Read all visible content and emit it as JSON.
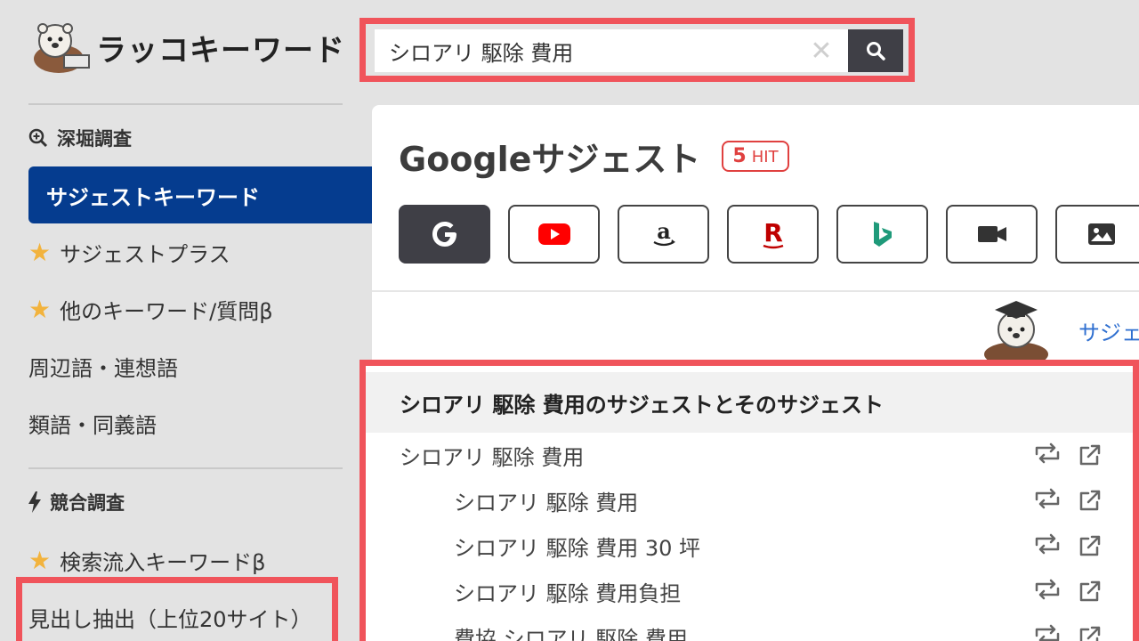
{
  "logo": {
    "text": "ラッコキーワード"
  },
  "search": {
    "value": "シロアリ 駆除 費用",
    "clear_label": "✕"
  },
  "sidebar": {
    "section1": "深堀調査",
    "active_item": "サジェストキーワード",
    "items1": [
      "サジェストプラス",
      "他のキーワード/質問β",
      "周辺語・連想語",
      "類語・同義語"
    ],
    "section2": "競合調査",
    "items2": [
      "検索流入キーワードβ",
      "見出し抽出（上位20サイト）"
    ]
  },
  "panel": {
    "title": "Googleサジェスト",
    "hit_count": "5",
    "hit_word": "HIT",
    "link_partial": "サジェ",
    "engines": [
      "google",
      "youtube",
      "amazon",
      "rakuten",
      "bing",
      "video",
      "image"
    ]
  },
  "results": {
    "header": "シロアリ 駆除 費用のサジェストとそのサジェスト",
    "rows": [
      {
        "text": "シロアリ 駆除 費用",
        "indent": 0
      },
      {
        "text": "シロアリ 駆除 費用",
        "indent": 1
      },
      {
        "text": "シロアリ 駆除 費用 30 坪",
        "indent": 1
      },
      {
        "text": "シロアリ 駆除 費用負担",
        "indent": 1
      },
      {
        "text": "費協 シロアリ 駆除 費用",
        "indent": 1
      }
    ]
  },
  "colors": {
    "accent": "#053c8f",
    "highlight": "#f0545b",
    "star": "#f2b33d",
    "badge": "#e0403f"
  }
}
